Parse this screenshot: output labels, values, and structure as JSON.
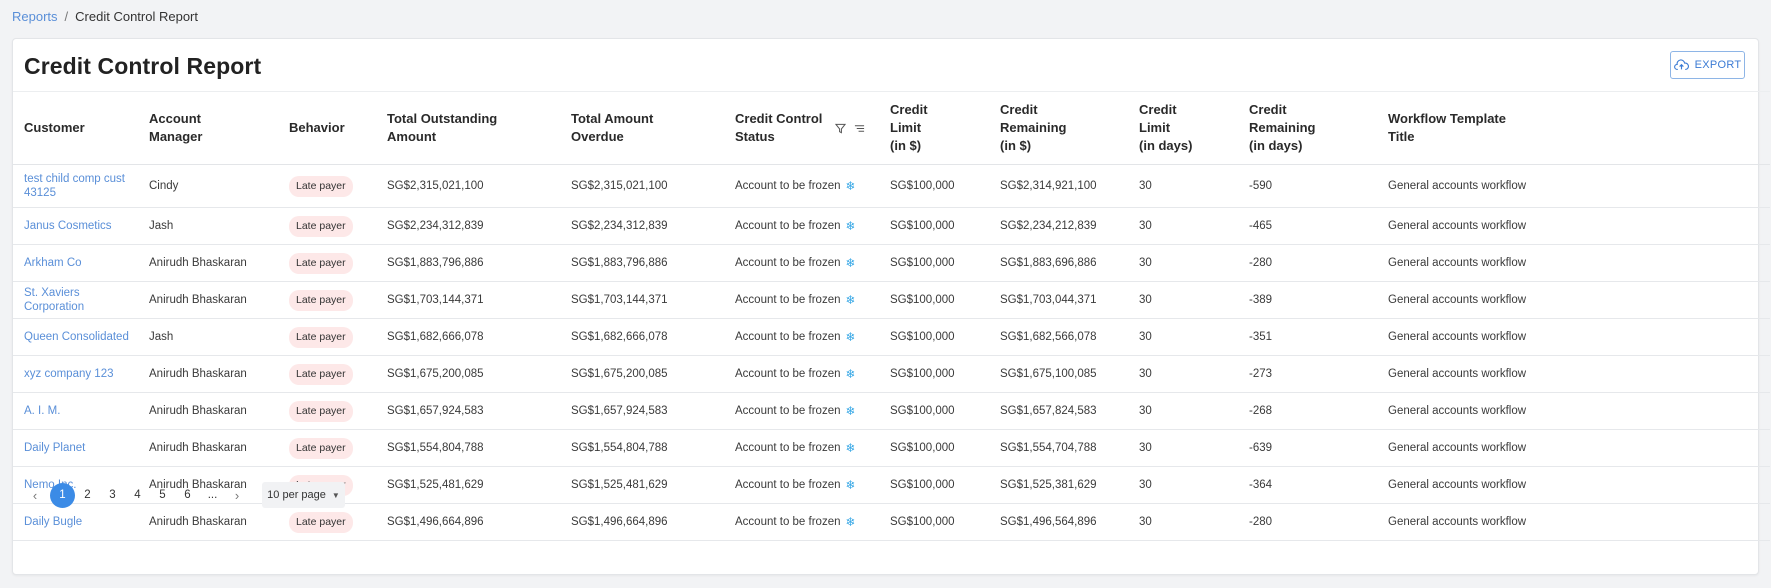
{
  "breadcrumb": {
    "parent": "Reports",
    "separator": "/",
    "current": "Credit Control Report"
  },
  "page": {
    "title": "Credit Control Report",
    "export_label": "EXPORT"
  },
  "table": {
    "headers": {
      "customer": "Customer",
      "account_manager": "Account\nManager",
      "behavior": "Behavior",
      "total_outstanding": "Total Outstanding\nAmount",
      "total_overdue": "Total Amount\nOverdue",
      "status": "Credit Control\nStatus",
      "credit_limit": "Credit\nLimit\n(in $)",
      "credit_remaining": "Credit\nRemaining\n(in $)",
      "limit_days": "Credit\nLimit\n(in days)",
      "remaining_days": "Credit\nRemaining\n(in days)",
      "workflow": "Workflow Template\nTitle"
    },
    "rows": [
      {
        "customer": "test child comp cust 43125",
        "manager": "Cindy",
        "behavior": "Late payer",
        "outstanding": "SG$2,315,021,100",
        "overdue": "SG$2,315,021,100",
        "status": "Account to be frozen",
        "limit": "SG$100,000",
        "remaining": "SG$2,314,921,100",
        "limit_days": "30",
        "remaining_days": "-590",
        "workflow": "General accounts workflow"
      },
      {
        "customer": "Janus Cosmetics",
        "manager": "Jash",
        "behavior": "Late payer",
        "outstanding": "SG$2,234,312,839",
        "overdue": "SG$2,234,312,839",
        "status": "Account to be frozen",
        "limit": "SG$100,000",
        "remaining": "SG$2,234,212,839",
        "limit_days": "30",
        "remaining_days": "-465",
        "workflow": "General accounts workflow"
      },
      {
        "customer": "Arkham Co",
        "manager": "Anirudh Bhaskaran",
        "behavior": "Late payer",
        "outstanding": "SG$1,883,796,886",
        "overdue": "SG$1,883,796,886",
        "status": "Account to be frozen",
        "limit": "SG$100,000",
        "remaining": "SG$1,883,696,886",
        "limit_days": "30",
        "remaining_days": "-280",
        "workflow": "General accounts workflow"
      },
      {
        "customer": "St. Xaviers Corporation",
        "manager": "Anirudh Bhaskaran",
        "behavior": "Late payer",
        "outstanding": "SG$1,703,144,371",
        "overdue": "SG$1,703,144,371",
        "status": "Account to be frozen",
        "limit": "SG$100,000",
        "remaining": "SG$1,703,044,371",
        "limit_days": "30",
        "remaining_days": "-389",
        "workflow": "General accounts workflow"
      },
      {
        "customer": "Queen Consolidated",
        "manager": "Jash",
        "behavior": "Late payer",
        "outstanding": "SG$1,682,666,078",
        "overdue": "SG$1,682,666,078",
        "status": "Account to be frozen",
        "limit": "SG$100,000",
        "remaining": "SG$1,682,566,078",
        "limit_days": "30",
        "remaining_days": "-351",
        "workflow": "General accounts workflow"
      },
      {
        "customer": "xyz company 123",
        "manager": "Anirudh Bhaskaran",
        "behavior": "Late payer",
        "outstanding": "SG$1,675,200,085",
        "overdue": "SG$1,675,200,085",
        "status": "Account to be frozen",
        "limit": "SG$100,000",
        "remaining": "SG$1,675,100,085",
        "limit_days": "30",
        "remaining_days": "-273",
        "workflow": "General accounts workflow"
      },
      {
        "customer": "A. I. M.",
        "manager": "Anirudh Bhaskaran",
        "behavior": "Late payer",
        "outstanding": "SG$1,657,924,583",
        "overdue": "SG$1,657,924,583",
        "status": "Account to be frozen",
        "limit": "SG$100,000",
        "remaining": "SG$1,657,824,583",
        "limit_days": "30",
        "remaining_days": "-268",
        "workflow": "General accounts workflow"
      },
      {
        "customer": "Daily Planet",
        "manager": "Anirudh Bhaskaran",
        "behavior": "Late payer",
        "outstanding": "SG$1,554,804,788",
        "overdue": "SG$1,554,804,788",
        "status": "Account to be frozen",
        "limit": "SG$100,000",
        "remaining": "SG$1,554,704,788",
        "limit_days": "30",
        "remaining_days": "-639",
        "workflow": "General accounts workflow"
      },
      {
        "customer": "Nemo Inc.",
        "manager": "Anirudh Bhaskaran",
        "behavior": "Late payer",
        "outstanding": "SG$1,525,481,629",
        "overdue": "SG$1,525,481,629",
        "status": "Account to be frozen",
        "limit": "SG$100,000",
        "remaining": "SG$1,525,381,629",
        "limit_days": "30",
        "remaining_days": "-364",
        "workflow": "General accounts workflow"
      },
      {
        "customer": "Daily Bugle",
        "manager": "Anirudh Bhaskaran",
        "behavior": "Late payer",
        "outstanding": "SG$1,496,664,896",
        "overdue": "SG$1,496,664,896",
        "status": "Account to be frozen",
        "limit": "SG$100,000",
        "remaining": "SG$1,496,564,896",
        "limit_days": "30",
        "remaining_days": "-280",
        "workflow": "General accounts workflow"
      }
    ]
  },
  "pagination": {
    "prev_icon": "chevron-left-icon",
    "next_icon": "chevron-right-icon",
    "pages": [
      "1",
      "2",
      "3",
      "4",
      "5",
      "6",
      "..."
    ],
    "current": "1",
    "per_page": "10 per page"
  },
  "colors": {
    "link": "#5a8fd8",
    "accent": "#3b8be6",
    "badge_bg": "#fde8e8",
    "frozen_icon": "#38a8e6"
  }
}
